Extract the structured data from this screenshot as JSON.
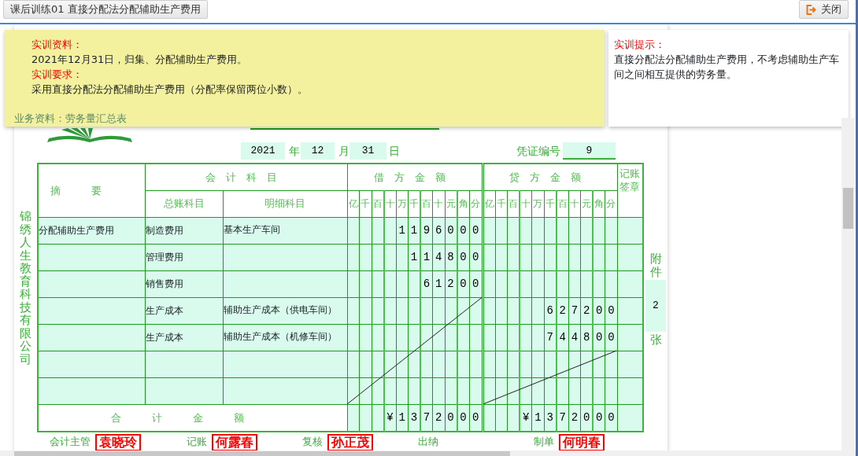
{
  "tab": {
    "label": "课后训练01 直接分配法分配辅助生产费用"
  },
  "close_button": {
    "label": "关闭"
  },
  "instructions": {
    "sections": [
      {
        "heading": "实训资料：",
        "text": "2021年12月31日，归集、分配辅助生产费用。"
      },
      {
        "heading": "实训要求：",
        "text": "采用直接分配法分配辅助生产费用（分配率保留两位小数）。"
      }
    ],
    "footer": "业务资料：劳务量汇总表"
  },
  "hint": {
    "heading": "实训提示：",
    "text": "直接分配法分配辅助生产费用，不考虑辅助生产车间之间相互提供的劳务量。"
  },
  "voucher": {
    "year": "2021",
    "year_label": "年",
    "month": "12",
    "month_label": "月",
    "day": "31",
    "day_label": "日",
    "number_label": "凭证编号",
    "number": "9",
    "company": "锦绣人生教育科技有限公司",
    "header": {
      "summary": "摘要",
      "accounts": "会计科目",
      "general_account": "总账科目",
      "detail_account": "明细科目",
      "debit": "借方金额",
      "credit": "贷方金额",
      "debit_units": [
        "亿",
        "千",
        "百",
        "十",
        "万",
        "千",
        "百",
        "十",
        "元",
        "角",
        "分"
      ],
      "credit_units": [
        "亿",
        "千",
        "百",
        "十",
        "万",
        "千",
        "百",
        "十",
        "元",
        "角",
        "分"
      ],
      "sign": "记账签章"
    },
    "rows": [
      {
        "summary": "分配辅助生产费用",
        "account": "制造费用",
        "detail": "基本生产车间",
        "debit": [
          "1",
          "1",
          "9",
          "6",
          "0",
          "0",
          "0"
        ]
      },
      {
        "account": "管理费用",
        "debit": [
          "1",
          "1",
          "4",
          "8",
          "0",
          "0"
        ]
      },
      {
        "account": "销售费用",
        "debit": [
          "6",
          "1",
          "2",
          "0",
          "0"
        ]
      },
      {
        "account": "生产成本",
        "detail": "辅助生产成本（供电车间）",
        "credit": [
          "6",
          "2",
          "7",
          "2",
          "0",
          "0"
        ]
      },
      {
        "account": "生产成本",
        "detail": "辅助生产成本（机修车间）",
        "credit": [
          "7",
          "4",
          "4",
          "8",
          "0",
          "0"
        ]
      },
      {},
      {}
    ],
    "total_label": "合计金额",
    "total_debit": [
      "¥",
      "1",
      "3",
      "7",
      "2",
      "0",
      "0",
      "0"
    ],
    "total_credit": [
      "¥",
      "1",
      "3",
      "7",
      "2",
      "0",
      "0",
      "0"
    ],
    "attachments_label_top": "附件",
    "attachments": "2",
    "attachments_label_bottom": "张",
    "signatures": [
      {
        "role": "会计主管",
        "name": "袁晓玲"
      },
      {
        "role": "记账",
        "name": "何露春"
      },
      {
        "role": "复核",
        "name": "孙正茂"
      },
      {
        "role": "出纳"
      },
      {
        "role": "制单",
        "name": "何明春"
      }
    ]
  }
}
